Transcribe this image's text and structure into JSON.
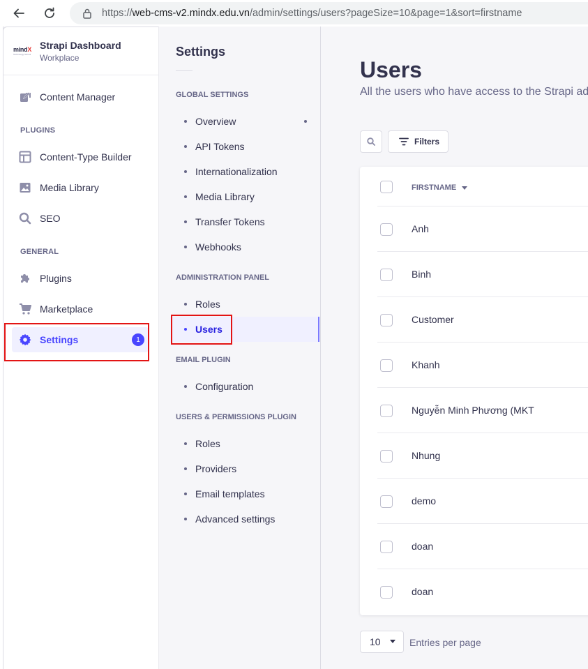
{
  "browser": {
    "url_scheme": "https://",
    "url_host": "web-cms-v2.mindx.edu.vn",
    "url_path": "/admin/settings/users?pageSize=10&page=1&sort=firstname"
  },
  "brand": {
    "logo_text_a": "mind",
    "logo_text_b": "X",
    "logo_tagline": "Technology School",
    "title": "Strapi Dashboard",
    "subtitle": "Workplace"
  },
  "main_nav": {
    "content_manager": "Content Manager",
    "plugins_section": "PLUGINS",
    "content_type_builder": "Content-Type Builder",
    "media_library": "Media Library",
    "seo": "SEO",
    "general_section": "GENERAL",
    "plugins": "Plugins",
    "marketplace": "Marketplace",
    "settings": "Settings",
    "settings_badge": "1"
  },
  "sub_nav": {
    "title": "Settings",
    "global_section": "GLOBAL SETTINGS",
    "global_items": [
      "Overview",
      "API Tokens",
      "Internationalization",
      "Media Library",
      "Transfer Tokens",
      "Webhooks"
    ],
    "admin_section": "ADMINISTRATION PANEL",
    "admin_items": [
      "Roles",
      "Users"
    ],
    "email_section": "EMAIL PLUGIN",
    "email_items": [
      "Configuration"
    ],
    "up_section": "USERS & PERMISSIONS PLUGIN",
    "up_items": [
      "Roles",
      "Providers",
      "Email templates",
      "Advanced settings"
    ]
  },
  "main": {
    "title": "Users",
    "subtitle": "All the users who have access to the Strapi admin panel",
    "filters_label": "Filters",
    "column_firstname": "FIRSTNAME",
    "rows": [
      "Anh",
      "Binh",
      "Customer",
      "Khanh",
      "Nguyễn Minh Phương (MKT",
      "Nhung",
      "demo",
      "doan",
      "doan"
    ],
    "page_size": "10",
    "entries_label": "Entries per page"
  },
  "colors": {
    "primary": "#4945ff",
    "highlight": "#e31414"
  }
}
